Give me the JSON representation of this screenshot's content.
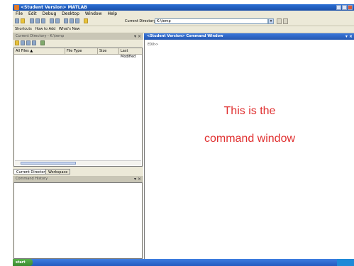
{
  "window": {
    "title": "<Student Version> MATLAB"
  },
  "menu": [
    "File",
    "Edit",
    "Debug",
    "Desktop",
    "Window",
    "Help"
  ],
  "toolbar": {
    "current_directory_label": "Current Directory:",
    "current_directory_value": "K:\\temp",
    "dropdown_glyph": "▾"
  },
  "shortcuts": {
    "items": [
      "Shortcuts",
      "How to Add",
      "What's New"
    ]
  },
  "current_directory_panel": {
    "title": "Current Directory - K:\\temp",
    "buttons": "▾ ×",
    "columns": [
      "All Files ▲",
      "File Type",
      "Size",
      "Last Modified"
    ]
  },
  "tabs": [
    "Current Directory",
    "Workspace"
  ],
  "command_history_panel": {
    "title": "Command History",
    "buttons": "▾ ×"
  },
  "command_window": {
    "title": "<Student Version> Command Window",
    "buttons": "▾ ×",
    "prompt": "EDU>>",
    "annotation_line1": "This is the",
    "annotation_line2": "command window"
  },
  "taskbar": {
    "start_label": "start"
  },
  "colors": {
    "title_bar": "#1b4fa8",
    "annotation": "#e03030",
    "chrome": "#ece9d8"
  }
}
